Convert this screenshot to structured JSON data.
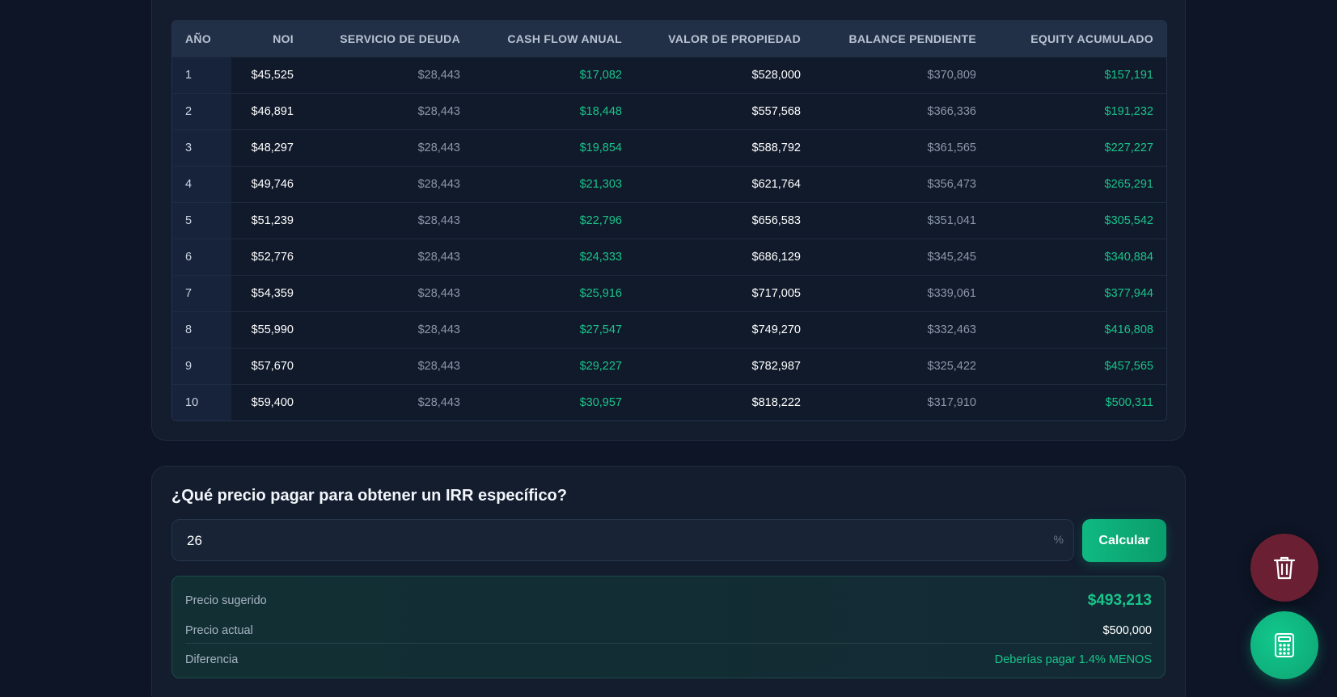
{
  "projection_table": {
    "headers": {
      "year": "AÑO",
      "noi": "NOI",
      "debt_service": "SERVICIO DE DEUDA",
      "cash_flow": "CASH FLOW ANUAL",
      "property_value": "VALOR DE PROPIEDAD",
      "balance": "BALANCE PENDIENTE",
      "equity": "EQUITY ACUMULADO"
    },
    "rows": [
      {
        "year": "1",
        "noi": "$45,525",
        "debt": "$28,443",
        "cash": "$17,082",
        "value": "$528,000",
        "balance": "$370,809",
        "equity": "$157,191"
      },
      {
        "year": "2",
        "noi": "$46,891",
        "debt": "$28,443",
        "cash": "$18,448",
        "value": "$557,568",
        "balance": "$366,336",
        "equity": "$191,232"
      },
      {
        "year": "3",
        "noi": "$48,297",
        "debt": "$28,443",
        "cash": "$19,854",
        "value": "$588,792",
        "balance": "$361,565",
        "equity": "$227,227"
      },
      {
        "year": "4",
        "noi": "$49,746",
        "debt": "$28,443",
        "cash": "$21,303",
        "value": "$621,764",
        "balance": "$356,473",
        "equity": "$265,291"
      },
      {
        "year": "5",
        "noi": "$51,239",
        "debt": "$28,443",
        "cash": "$22,796",
        "value": "$656,583",
        "balance": "$351,041",
        "equity": "$305,542"
      },
      {
        "year": "6",
        "noi": "$52,776",
        "debt": "$28,443",
        "cash": "$24,333",
        "value": "$686,129",
        "balance": "$345,245",
        "equity": "$340,884"
      },
      {
        "year": "7",
        "noi": "$54,359",
        "debt": "$28,443",
        "cash": "$25,916",
        "value": "$717,005",
        "balance": "$339,061",
        "equity": "$377,944"
      },
      {
        "year": "8",
        "noi": "$55,990",
        "debt": "$28,443",
        "cash": "$27,547",
        "value": "$749,270",
        "balance": "$332,463",
        "equity": "$416,808"
      },
      {
        "year": "9",
        "noi": "$57,670",
        "debt": "$28,443",
        "cash": "$29,227",
        "value": "$782,987",
        "balance": "$325,422",
        "equity": "$457,565"
      },
      {
        "year": "10",
        "noi": "$59,400",
        "debt": "$28,443",
        "cash": "$30,957",
        "value": "$818,222",
        "balance": "$317,910",
        "equity": "$500,311"
      }
    ]
  },
  "irr_calculator": {
    "title": "¿Qué precio pagar para obtener un IRR específico?",
    "input_value": "26",
    "input_suffix": "%",
    "button_label": "Calcular",
    "suggested_label": "Precio sugerido",
    "suggested_value": "$493,213",
    "current_label": "Precio actual",
    "current_value": "$500,000",
    "difference_label": "Diferencia",
    "difference_value": "Deberías pagar 1.4% MENOS"
  },
  "fabs": {
    "delete_icon": "trash-icon",
    "calculator_icon": "calculator-icon"
  },
  "colors": {
    "background": "#0d1526",
    "accent_green": "#19c48a",
    "delete_red": "#6b1f33"
  }
}
